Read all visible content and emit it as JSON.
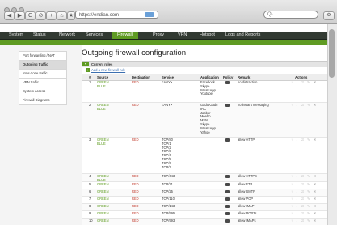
{
  "browser": {
    "url": "https://endian.com",
    "search_placeholder": "Q-",
    "toolbar_glyphs": [
      "◀",
      "▶",
      "C",
      "⊘",
      "+",
      "⌂",
      "★"
    ],
    "right_button": "⚙"
  },
  "nav": {
    "items": [
      "System",
      "Status",
      "Network",
      "Services",
      "Firewall",
      "Proxy",
      "VPN",
      "Hotspot",
      "Logs and Reports"
    ],
    "active": "Firewall"
  },
  "sidebar": {
    "items": [
      "Port forwarding / NAT",
      "Outgoing traffic",
      "Inter-Zone traffic",
      "VPN traffic",
      "System access",
      "Firewall Diagrams"
    ],
    "active": "Outgoing traffic"
  },
  "page": {
    "title": "Outgoing firewall configuration",
    "section_label": "Current rules",
    "add_rule_label": "Add a new firewall rule"
  },
  "table": {
    "headers": [
      "#",
      "Source",
      "Destination",
      "Service",
      "Application",
      "Policy",
      "Remark",
      "Actions"
    ],
    "rows": [
      {
        "num": "1",
        "source": "GREEN\nBLUE",
        "destination": "RED",
        "service": "<ANY>",
        "application": "Facebook\nSkype\nWhatsApp\nYoutube",
        "remark": "no distraction"
      },
      {
        "num": "2",
        "source": "GREEN\nBLUE",
        "destination": "RED",
        "service": "<ANY>",
        "application": "Gadu-Gadu\nIRC\nJabber\nMeebo\nMSN\nSkype\nWhatsApp\nYahoo",
        "remark": "no instant messaging"
      },
      {
        "num": "3",
        "source": "GREEN\nBLUE",
        "destination": "RED",
        "service": "TCP/80\nTCP/1\nTCP/2\nTCP/3\nTCP/4\nTCP/5\nTCP/6\nTCP/7",
        "application": "",
        "remark": "allow HTTP"
      },
      {
        "num": "4",
        "source": "GREEN\nBLUE",
        "destination": "RED",
        "service": "TCP/443",
        "application": "",
        "remark": "allow HTTPS"
      },
      {
        "num": "5",
        "source": "GREEN",
        "destination": "RED",
        "service": "TCP/21",
        "application": "",
        "remark": "allow FTP"
      },
      {
        "num": "6",
        "source": "GREEN",
        "destination": "RED",
        "service": "TCP/25",
        "application": "",
        "remark": "allow SMTP"
      },
      {
        "num": "7",
        "source": "GREEN",
        "destination": "RED",
        "service": "TCP/110",
        "application": "",
        "remark": "allow POP"
      },
      {
        "num": "8",
        "source": "GREEN",
        "destination": "RED",
        "service": "TCP/143",
        "application": "",
        "remark": "allow IMAP"
      },
      {
        "num": "9",
        "source": "GREEN",
        "destination": "RED",
        "service": "TCP/995",
        "application": "",
        "remark": "allow POP3s"
      },
      {
        "num": "10",
        "source": "GREEN",
        "destination": "RED",
        "service": "TCP/993",
        "application": "",
        "remark": "allow IMAPs"
      }
    ],
    "action_glyphs": "↑ ↓ ☑ ✎ ✖"
  },
  "colors": {
    "nav_bg": "#323a32",
    "accent_green": "#5f9b23",
    "zone_green": "#5a9a1a",
    "zone_red": "#c0392b"
  }
}
